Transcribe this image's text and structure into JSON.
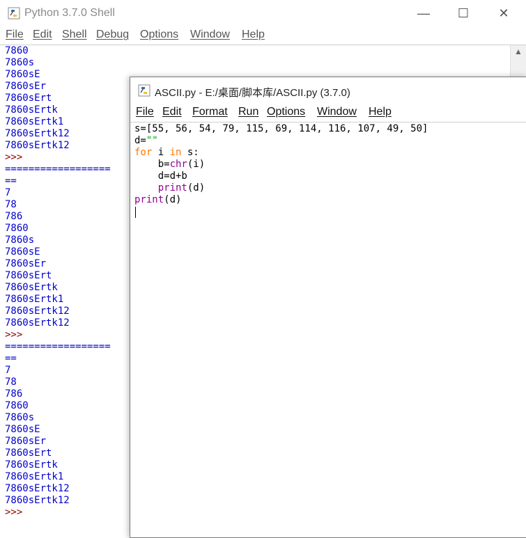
{
  "shell": {
    "title": "Python 3.7.0 Shell",
    "window_controls": {
      "minimize": "—",
      "maximize": "☐",
      "close": "✕"
    },
    "menu": [
      "File",
      "Edit",
      "Shell",
      "Debug",
      "Options",
      "Window",
      "Help"
    ],
    "output_lines": [
      "7860",
      "7860s",
      "7860sE",
      "7860sEr",
      "7860sErt",
      "7860sErtk",
      "7860sErtk1",
      "7860sErtk12",
      "7860sErtk12",
      ">>>",
      "==================",
      "==",
      "7",
      "78",
      "786",
      "7860",
      "7860s",
      "7860sE",
      "7860sEr",
      "7860sErt",
      "7860sErtk",
      "7860sErtk1",
      "7860sErtk12",
      "7860sErtk12",
      ">>>",
      "==================",
      "==",
      "7",
      "78",
      "786",
      "7860",
      "7860s",
      "7860sE",
      "7860sEr",
      "7860sErt",
      "7860sErtk",
      "7860sErtk1",
      "7860sErtk12",
      "7860sErtk12",
      ">>>"
    ]
  },
  "editor": {
    "title": "ASCII.py - E:/桌面/脚本库/ASCII.py (3.7.0)",
    "menu": [
      "File",
      "Edit",
      "Format",
      "Run",
      "Options",
      "Window",
      "Help"
    ],
    "code": {
      "line1": "s=[55, 56, 54, 79, 115, 69, 114, 116, 107, 49, 50]",
      "line2_a": "d=",
      "line2_b": "\"\"",
      "line3_kw1": "for",
      "line3_mid": " i ",
      "line3_kw2": "in",
      "line3_end": " s:",
      "line4_a": "    b=",
      "line4_bi": "chr",
      "line4_b": "(i)",
      "line5": "    d=d+b",
      "line6_a": "    ",
      "line6_bi": "print",
      "line6_b": "(d)",
      "line7_bi": "print",
      "line7_b": "(d)"
    }
  },
  "colors": {
    "keyword": "#ff7700",
    "builtin": "#900090",
    "string": "#00aa00",
    "output": "#0000cc",
    "prompt": "#8b0000"
  }
}
